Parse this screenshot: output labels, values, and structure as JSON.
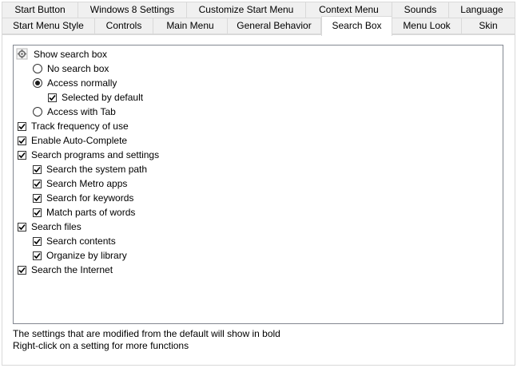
{
  "tabs": {
    "row1": [
      {
        "label": "Start Button"
      },
      {
        "label": "Windows 8 Settings"
      },
      {
        "label": "Customize Start Menu"
      },
      {
        "label": "Context Menu"
      },
      {
        "label": "Sounds"
      },
      {
        "label": "Language"
      }
    ],
    "row2": [
      {
        "label": "Start Menu Style"
      },
      {
        "label": "Controls"
      },
      {
        "label": "Main Menu"
      },
      {
        "label": "General Behavior"
      },
      {
        "label": "Search Box"
      },
      {
        "label": "Menu Look"
      },
      {
        "label": "Skin"
      }
    ],
    "active": "Search Box"
  },
  "settings": [
    {
      "label": "Show search box",
      "control": "group-icon",
      "icon": "settings-gear-icon"
    },
    {
      "label": "No search box",
      "control": "radio",
      "selected": false
    },
    {
      "label": "Access normally",
      "control": "radio",
      "selected": true
    },
    {
      "label": "Selected by default",
      "control": "checkbox",
      "checked": true
    },
    {
      "label": "Access with Tab",
      "control": "radio",
      "selected": false
    },
    {
      "label": "Track frequency of use",
      "control": "checkbox",
      "checked": true
    },
    {
      "label": "Enable Auto-Complete",
      "control": "checkbox",
      "checked": true
    },
    {
      "label": "Search programs and settings",
      "control": "checkbox",
      "checked": true
    },
    {
      "label": "Search the system path",
      "control": "checkbox",
      "checked": true
    },
    {
      "label": "Search Metro apps",
      "control": "checkbox",
      "checked": true
    },
    {
      "label": "Search for keywords",
      "control": "checkbox",
      "checked": true
    },
    {
      "label": "Match parts of words",
      "control": "checkbox",
      "checked": true
    },
    {
      "label": "Search files",
      "control": "checkbox",
      "checked": true
    },
    {
      "label": "Search contents",
      "control": "checkbox",
      "checked": true
    },
    {
      "label": "Organize by library",
      "control": "checkbox",
      "checked": true
    },
    {
      "label": "Search the Internet",
      "control": "checkbox",
      "checked": true
    }
  ],
  "status": {
    "line1": "The settings that are modified from the default will show in bold",
    "line2": "Right-click on a setting for more functions"
  }
}
